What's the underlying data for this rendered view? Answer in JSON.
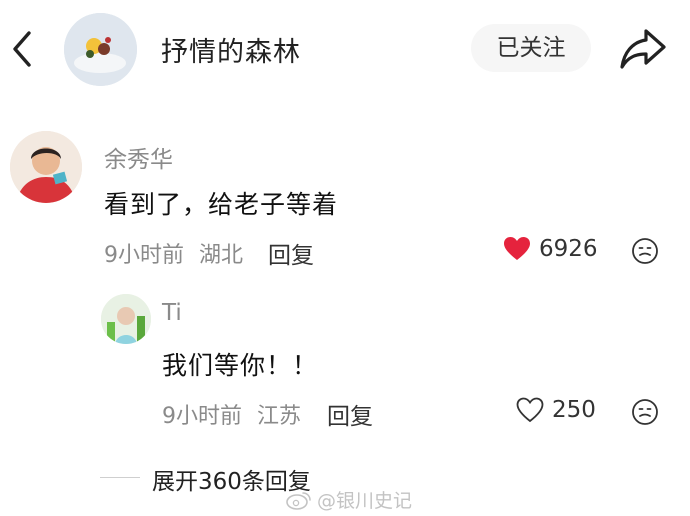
{
  "header": {
    "title": "抒情的森林",
    "follow_label": "已关注"
  },
  "comment": {
    "user": "余秀华",
    "text": "看到了，给老子等着",
    "time": "9小时前",
    "location": "湖北",
    "reply_label": "回复",
    "likes": "6926",
    "like_color": "#e5233d"
  },
  "reply": {
    "user": "Ti",
    "text": "我们等你！！",
    "time": "9小时前",
    "location": "江苏",
    "reply_label": "回复",
    "likes": "250"
  },
  "expand_label": "展开360条回复",
  "watermark": "@银川史记"
}
